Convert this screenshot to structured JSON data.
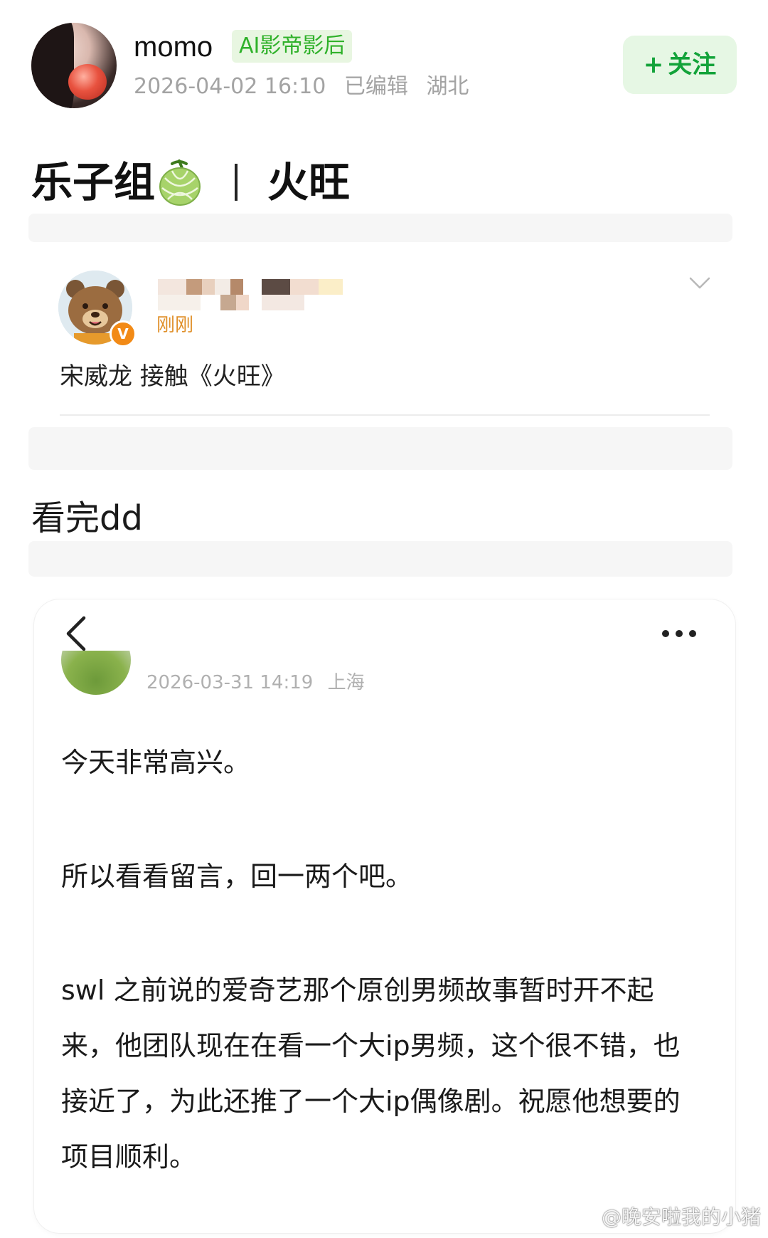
{
  "header": {
    "username": "momo",
    "badge": "AI影帝影后",
    "date": "2026-04-02 16:10",
    "edited": "已编辑",
    "location": "湖北",
    "follow_plus": "+",
    "follow_label": "关注",
    "accent_color": "#13a33a"
  },
  "title": {
    "left": "乐子组",
    "icon": "melon-icon",
    "right": "火旺"
  },
  "quoted_post": {
    "time": "刚刚",
    "verified_mark": "V",
    "text": "宋威龙 接触《火旺》"
  },
  "body": {
    "text": "看完dd"
  },
  "screenshot": {
    "date": "2026-03-31 14:19",
    "location": "上海",
    "paragraphs": [
      "今天非常高兴。",
      "所以看看留言，回一两个吧。",
      "swl 之前说的爱奇艺那个原创男频故事暂时开不起来，他团队现在在看一个大ip男频，这个很不错，也接近了，为此还推了一个大ip偶像剧。祝愿他想要的项目顺利。"
    ]
  },
  "watermark": {
    "text": "@晚安啦我的小猪"
  }
}
